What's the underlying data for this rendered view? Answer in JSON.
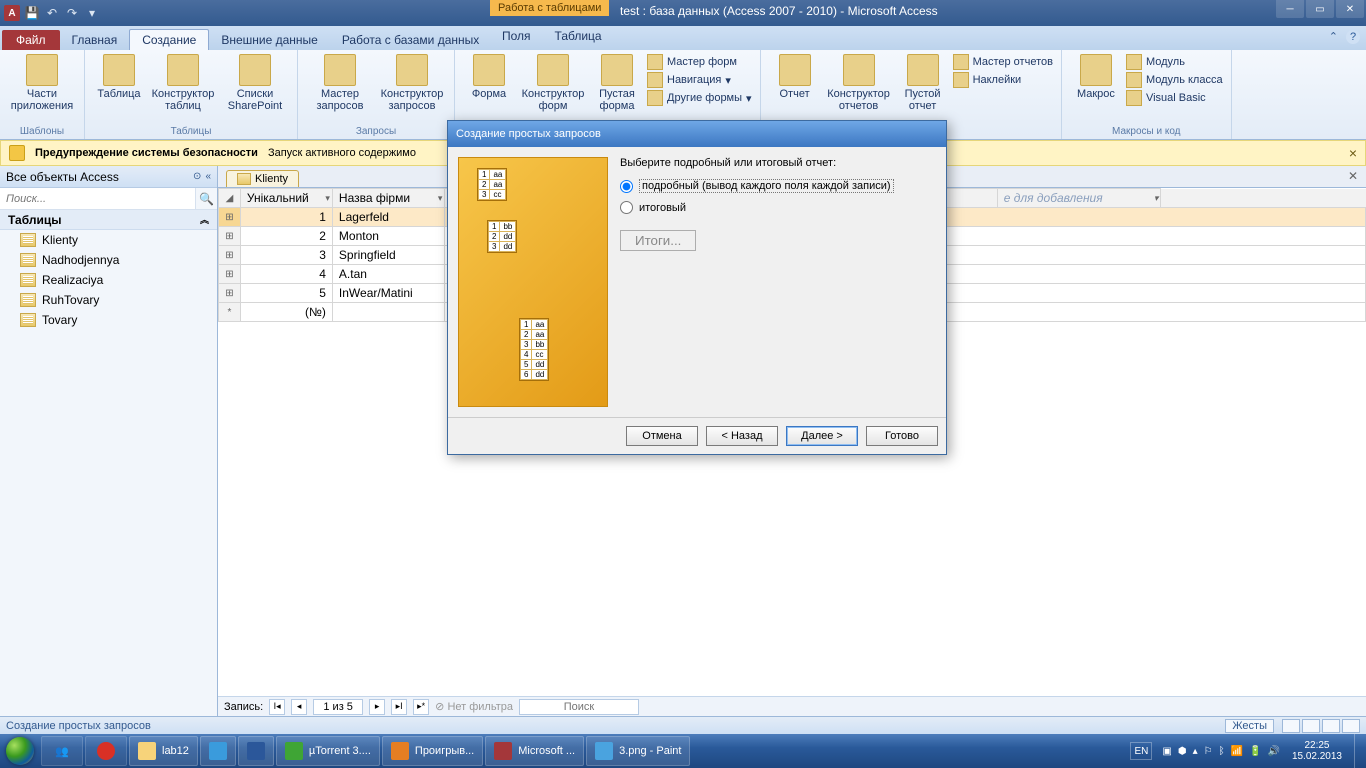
{
  "window": {
    "context_title": "Работа с таблицами",
    "app_title": "test : база данных (Access 2007 - 2010)  -  Microsoft Access"
  },
  "tabs": {
    "file": "Файл",
    "home": "Главная",
    "create": "Создание",
    "external": "Внешние данные",
    "dbtools": "Работа с базами данных",
    "fields": "Поля",
    "table": "Таблица"
  },
  "ribbon": {
    "templates": {
      "parts": "Части\nприложения",
      "label": "Шаблоны"
    },
    "tables": {
      "table": "Таблица",
      "designer": "Конструктор\nтаблиц",
      "sharepoint": "Списки\nSharePoint",
      "label": "Таблицы"
    },
    "queries": {
      "wizard": "Мастер\nзапросов",
      "designer": "Конструктор\nзапросов",
      "label": "Запросы"
    },
    "forms": {
      "form": "Форма",
      "designer": "Конструктор\nформ",
      "blank": "Пустая\nформа",
      "form_wizard": "Мастер форм",
      "navigation": "Навигация",
      "other": "Другие формы",
      "label": "Формы"
    },
    "reports": {
      "report": "Отчет",
      "designer": "Конструктор\nотчетов",
      "blank": "Пустой\nотчет",
      "report_wizard": "Мастер отчетов",
      "labels": "Наклейки",
      "label_group": "Отчеты"
    },
    "macros": {
      "macro": "Макрос",
      "module": "Модуль",
      "class_module": "Модуль класса",
      "vb": "Visual Basic",
      "label": "Макросы и код"
    }
  },
  "security": {
    "title": "Предупреждение системы безопасности",
    "msg": "Запуск активного содержимо"
  },
  "nav": {
    "header": "Все объекты Access",
    "search_placeholder": "Поиск...",
    "category": "Таблицы",
    "items": [
      "Klienty",
      "Nadhodjennya",
      "Realizaciya",
      "RuhTovary",
      "Tovary"
    ]
  },
  "datasheet": {
    "tab": "Klienty",
    "col1": "Унікальний",
    "col2": "Назва фірми",
    "addcol": "е для добавления",
    "rows": [
      {
        "id": "1",
        "name": "Lagerfeld"
      },
      {
        "id": "2",
        "name": "Monton"
      },
      {
        "id": "3",
        "name": "Springfield"
      },
      {
        "id": "4",
        "name": "A.tan"
      },
      {
        "id": "5",
        "name": "InWear/Matini"
      }
    ],
    "newrow": "(№)",
    "recnav": {
      "label": "Запись:",
      "pos": "1 из 5",
      "nofilter": "Нет фильтра",
      "search": "Поиск"
    }
  },
  "dialog": {
    "title": "Создание простых запросов",
    "prompt": "Выберите подробный или итоговый отчет:",
    "opt_detail": "подробный (вывод каждого поля каждой записи)",
    "opt_summary": "итоговый",
    "totals_btn": "Итоги...",
    "cancel": "Отмена",
    "back": "< Назад",
    "next": "Далее >",
    "finish": "Готово"
  },
  "statusbar": {
    "text": "Создание простых запросов",
    "gestures": "Жесты"
  },
  "taskbar": {
    "items": [
      "lab12",
      "",
      "",
      "µTorrent 3....",
      "Проигрыв...",
      "Microsoft ...",
      "3.png - Paint"
    ],
    "lang": "EN",
    "time": "22:25",
    "date": "15.02.2013"
  }
}
